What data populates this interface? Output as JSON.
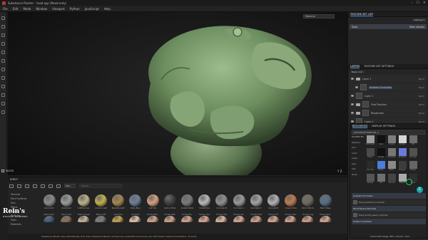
{
  "window": {
    "title": "Substance Painter - toad.spp (Read-only)",
    "controls": [
      "–",
      "☐",
      "✕"
    ]
  },
  "menu": [
    "File",
    "Edit",
    "Mode",
    "Window",
    "Viewport",
    "Python",
    "JavaScript",
    "Help"
  ],
  "viewport": {
    "material_dropdown": "Material",
    "label": "3D/2D",
    "axis": "Y Z"
  },
  "texture_set_list": {
    "header": "TEXTURE SET LIST",
    "settings": "Settings ▾",
    "row_name": "Toad",
    "row_shader": "Main shader"
  },
  "layers": {
    "tabs": [
      "LAYERS",
      "TEXTURE SET SETTINGS"
    ],
    "channel": "Base color",
    "items": [
      {
        "name": "Layer 1",
        "blend": "Norm"
      },
      {
        "name": "Ambient Occlusion",
        "blend": "Norm"
      },
      {
        "name": "Layer 1",
        "blend": "Norm"
      },
      {
        "name": "Final Touches",
        "blend": "Norm"
      },
      {
        "name": "Roughness",
        "blend": "Norm"
      },
      {
        "name": "Layer 1",
        "blend": "Norm"
      }
    ]
  },
  "resources": {
    "tabs": [
      "RESOURCES",
      "DISPLAY SETTINGS"
    ],
    "search": "procedural textures ✕",
    "left_labels": [
      "PROPERTIES",
      "Displace",
      "Grid",
      "Scale",
      "Angle",
      "Type",
      "Size",
      "Noise"
    ],
    "swatch_labels": [
      "BnW Spots",
      "Cells",
      "Clouds",
      "Crystal",
      "Dirt",
      "Fibers",
      "Fractal",
      "Gaussian",
      "Gradient",
      "Grunge",
      "Hex Tile",
      "Noise",
      "Perlin",
      "Polygon",
      "Shape",
      "Stripes",
      "Tile",
      "Voronoi",
      "Weave",
      "Wood"
    ],
    "props": [
      {
        "label": "Ambient Occlusion",
        "hdr": true
      },
      {
        "label": "Toad_ambient_occlusion",
        "hdr": false
      },
      {
        "label": "World Space Normals",
        "hdr": true
      },
      {
        "label": "Toad_world_space_normals",
        "hdr": false
      },
      {
        "label": "Position Gradient",
        "hdr": true
      }
    ]
  },
  "shelf": {
    "header": "SHELF",
    "filter": "Mat…",
    "search_placeholder": "Search...",
    "categories": [
      "Textures",
      "Hard Surfaces",
      "Skin",
      "Filters",
      "Brushes",
      "Particles",
      "Tools",
      "Materials"
    ],
    "row1": [
      "Aluminium",
      "Aluminium",
      "Artificial Lea.",
      "Autumn Leaf",
      "Bakelite Light",
      "Baby Blue",
      "Calf Skin",
      "Carbon Fiber",
      "Coated Metal",
      "Cobalt Pure",
      "Concrete B.",
      "Concrete C.",
      "Concrete D.",
      "Concrete E.",
      "Copper Pure",
      "Fabric Bamb.",
      "Fabric Base"
    ],
    "row2": [
      "Fabric Deni.",
      "Fabric Knit",
      "Fabric Rough",
      "Fabric Soft",
      "Gold Pure",
      "Gouache",
      "Human Bac.",
      "Human Bell.",
      "Human Bu.",
      "Human Che.",
      "Human Eye",
      "Human Fac.",
      "Human Feet",
      "Human For.",
      "Human Hea.",
      "Human Leg",
      "Human Nec."
    ],
    "row1_colors": [
      "#8a8a8a",
      "#9a9a9a",
      "#bfb08a",
      "#c2b04a",
      "#a8864d",
      "#6b7f9a",
      "#d6a07e",
      "#404040",
      "#7a7a7a",
      "#b8b8b8",
      "#8f8f8f",
      "#999999",
      "#a3a3a3",
      "#b2b2b2",
      "#c07a4f",
      "#6e6a5e",
      "#566c86"
    ],
    "row2_colors": [
      "#3f5a7a",
      "#8b6f5a",
      "#c9b59a",
      "#7e7e7e",
      "#c9a24a",
      "#e3c3a5",
      "#d9a48a",
      "#d4a189",
      "#d6a58c",
      "#d8a98f",
      "#e2b9a0",
      "#dca890",
      "#d5a085",
      "#d9a68d",
      "#d7a38b",
      "#d3a087",
      "#d8a78e"
    ]
  },
  "status": {
    "message": "Substance Painter may automatically shut down Substance Painter during long computations because your GPU doesn't support preemption. To avoid",
    "right": "Cache Disk Usage: 96% | Version: 2.6.2"
  },
  "watermark": {
    "line1": "Rein's",
    "line2": "DIGITAL ACADEMY"
  },
  "cursor_badge": "C"
}
